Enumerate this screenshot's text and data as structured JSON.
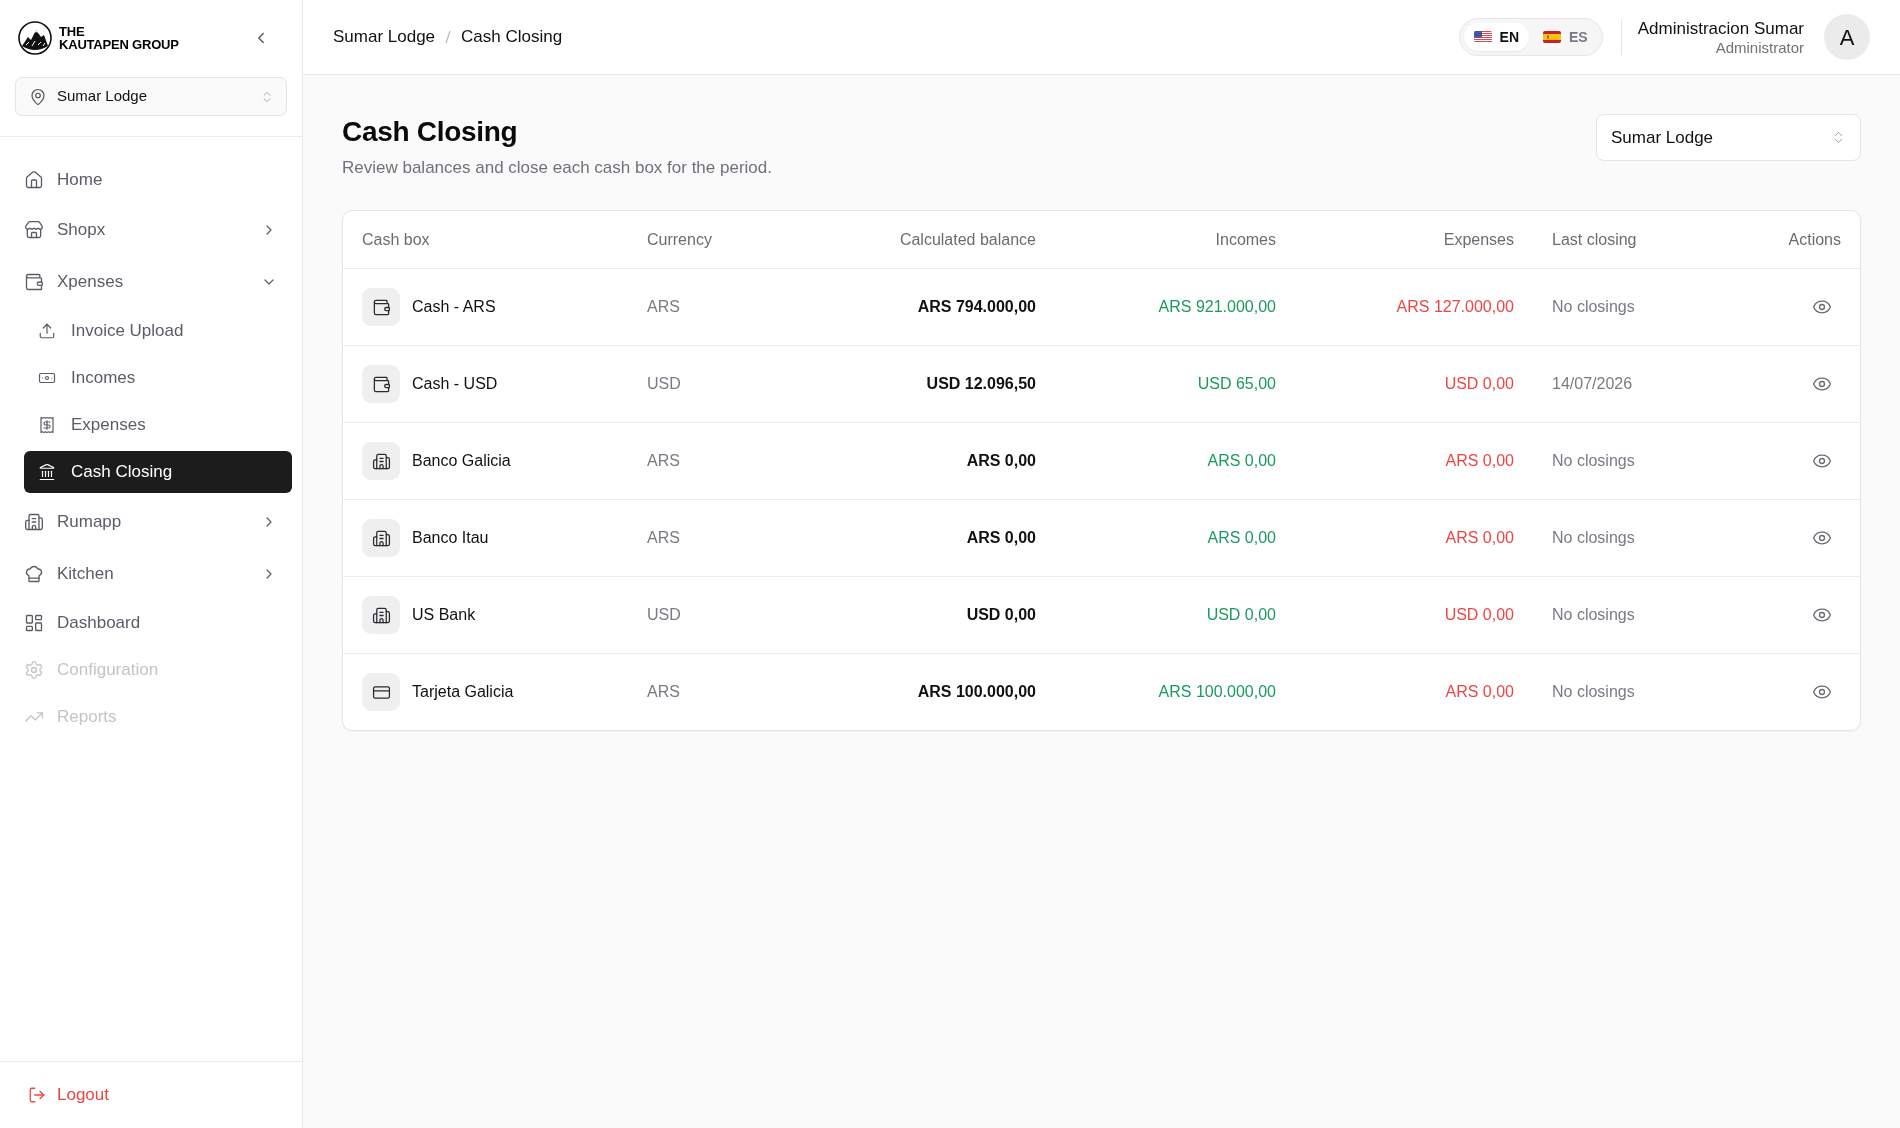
{
  "sidebar": {
    "logo": {
      "lines": [
        "THE",
        "KAUTAPEN GROUP"
      ]
    },
    "location_select": {
      "value": "Sumar Lodge"
    },
    "nav": [
      {
        "label": "Home",
        "kind": "link",
        "selected": false,
        "disabled": false
      },
      {
        "label": "Shopx",
        "kind": "group",
        "expanded": false,
        "selected": false,
        "disabled": false
      },
      {
        "label": "Xpenses",
        "kind": "group",
        "expanded": true,
        "selected": false,
        "disabled": false,
        "children": [
          {
            "label": "Invoice Upload",
            "selected": false,
            "disabled": false
          },
          {
            "label": "Incomes",
            "selected": false,
            "disabled": false
          },
          {
            "label": "Expenses",
            "selected": false,
            "disabled": false
          },
          {
            "label": "Cash Closing",
            "selected": true,
            "disabled": false
          }
        ]
      },
      {
        "label": "Rumapp",
        "kind": "group",
        "expanded": false,
        "selected": false,
        "disabled": false
      },
      {
        "label": "Kitchen",
        "kind": "group",
        "expanded": false,
        "selected": false,
        "disabled": false
      },
      {
        "label": "Dashboard",
        "kind": "link",
        "selected": false,
        "disabled": false
      },
      {
        "label": "Configuration",
        "kind": "link",
        "selected": false,
        "disabled": true
      },
      {
        "label": "Reports",
        "kind": "link",
        "selected": false,
        "disabled": true
      }
    ],
    "logout": {
      "label": "Logout"
    }
  },
  "header": {
    "breadcrumb": [
      "Sumar Lodge",
      "Cash Closing"
    ],
    "languages": [
      {
        "code": "EN",
        "selected": true
      },
      {
        "code": "ES",
        "selected": false
      }
    ],
    "user": {
      "name": "Administracion Sumar",
      "role": "Administrator",
      "initial": "A"
    }
  },
  "page": {
    "title": "Cash Closing",
    "subtitle": "Review balances and close each cash box for the period.",
    "lodge_select": {
      "value": "Sumar Lodge"
    }
  },
  "table": {
    "columns": [
      "Cash box",
      "Currency",
      "Calculated balance",
      "Incomes",
      "Expenses",
      "Last closing",
      "Actions"
    ],
    "rows": [
      {
        "kind": "cash",
        "name": "Cash - ARS",
        "currency": "ARS",
        "balance": "ARS 794.000,00",
        "incomes": "ARS 921.000,00",
        "expenses": "ARS 127.000,00",
        "last_closing": "No closings"
      },
      {
        "kind": "cash",
        "name": "Cash - USD",
        "currency": "USD",
        "balance": "USD 12.096,50",
        "incomes": "USD 65,00",
        "expenses": "USD 0,00",
        "last_closing": "14/07/2026"
      },
      {
        "kind": "bank",
        "name": "Banco Galicia",
        "currency": "ARS",
        "balance": "ARS 0,00",
        "incomes": "ARS 0,00",
        "expenses": "ARS 0,00",
        "last_closing": "No closings"
      },
      {
        "kind": "bank",
        "name": "Banco Itau",
        "currency": "ARS",
        "balance": "ARS 0,00",
        "incomes": "ARS 0,00",
        "expenses": "ARS 0,00",
        "last_closing": "No closings"
      },
      {
        "kind": "bank",
        "name": "US Bank",
        "currency": "USD",
        "balance": "USD 0,00",
        "incomes": "USD 0,00",
        "expenses": "USD 0,00",
        "last_closing": "No closings"
      },
      {
        "kind": "card",
        "name": "Tarjeta Galicia",
        "currency": "ARS",
        "balance": "ARS 100.000,00",
        "incomes": "ARS 100.000,00",
        "expenses": "ARS 0,00",
        "last_closing": "No closings"
      }
    ]
  }
}
